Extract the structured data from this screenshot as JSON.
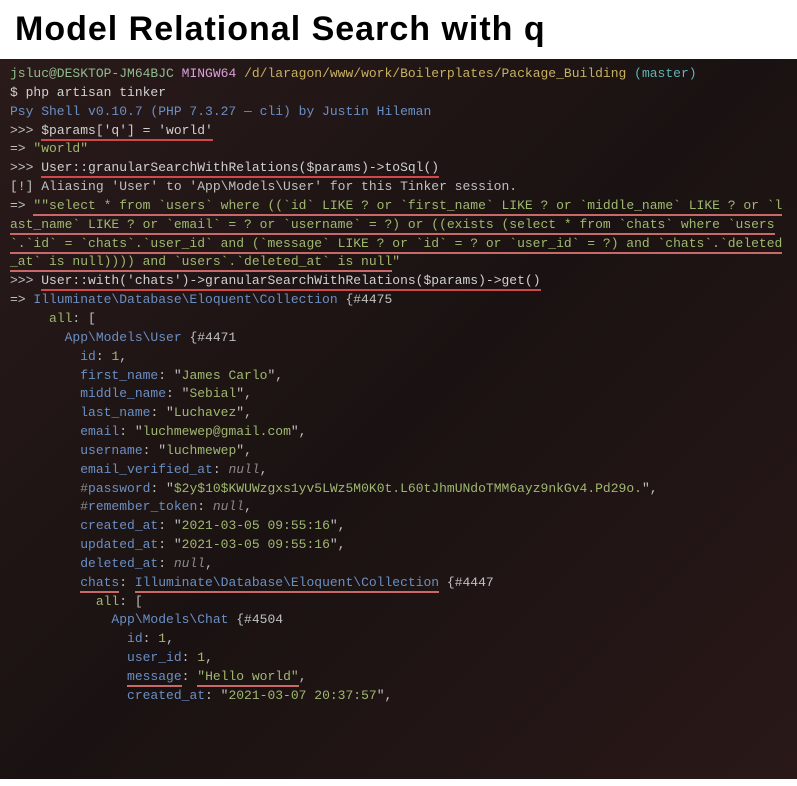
{
  "title": "Model Relational Search with q",
  "prompt": {
    "user": "jsluc@DESKTOP-JM64BJC",
    "env": "MINGW64",
    "path": "/d/laragon/www/work/Boilerplates/Package_Building",
    "branch": "(master)"
  },
  "lines": {
    "cmd1": "$ php artisan tinker",
    "shell": "Psy Shell v0.10.7 (PHP 7.3.27 — cli) by Justin Hileman",
    "input1_prefix": ">>> ",
    "input1": "$params['q'] = 'world'",
    "output1_prefix": "=> ",
    "output1_quote": "\"",
    "output1": "world",
    "input2_prefix": ">>> ",
    "input2": "User::granularSearchWithRelations($params)->toSql()",
    "alias": "[!] Aliasing 'User' to 'App\\Models\\User' for this Tinker session.",
    "output2_prefix": "=> ",
    "sql": "\"select * from `users` where ((`id` LIKE ? or `first_name` LIKE ? or `middle_name` LIKE ? or `last_name` LIKE ? or `email` = ? or `username` = ?) or ((exists (select * from `chats` where `users`.`id` = `chats`.`user_id` and (`message` LIKE ? or `id` = ? or `user_id` = ?) and `chats`.`deleted_at` is null)))) and `users`.`deleted_at` is null",
    "sql_close": "\"",
    "input3_prefix": ">>> ",
    "input3": "User::with('chats')->granularSearchWithRelations($params)->get()",
    "output3_prefix": "=> ",
    "collection_class": "Illuminate\\Database\\Eloquent\\Collection",
    "collection_id": " {#4475",
    "all_label": "all",
    "bracket_open": ": [",
    "user_class": "App\\Models\\User",
    "user_id": " {#4471",
    "fields": {
      "id_k": "id",
      "id_v": "1",
      "first_name_k": "first_name",
      "first_name_v": "James Carlo",
      "middle_name_k": "middle_name",
      "middle_name_v": "Sebial",
      "last_name_k": "last_name",
      "last_name_v": "Luchavez",
      "email_k": "email",
      "email_v": "luchmewep@gmail.com",
      "username_k": "username",
      "username_v": "luchmewep",
      "email_verified_k": "email_verified_at",
      "email_verified_v": "null",
      "password_k": "password",
      "password_v": "$2y$10$KWUWzgxs1yv5LWz5M0K0t.L60tJhmUNdoTMM6ayz9nkGv4.Pd29o.",
      "remember_k": "remember_token",
      "remember_v": "null",
      "created_k": "created_at",
      "created_v": "2021-03-05 09:55:16",
      "updated_k": "updated_at",
      "updated_v": "2021-03-05 09:55:16",
      "deleted_k": "deleted_at",
      "deleted_v": "null",
      "chats_k": "chats",
      "chats_class": "Illuminate\\Database\\Eloquent\\Collection",
      "chats_id": " {#4447"
    },
    "chat_class": "App\\Models\\Chat",
    "chat_inst_id": " {#4504",
    "chat": {
      "id_k": "id",
      "id_v": "1",
      "user_id_k": "user_id",
      "user_id_v": "1",
      "message_k": "message",
      "message_v": "Hello world",
      "created_k": "created_at",
      "created_v": "2021-03-07 20:37:57"
    }
  }
}
